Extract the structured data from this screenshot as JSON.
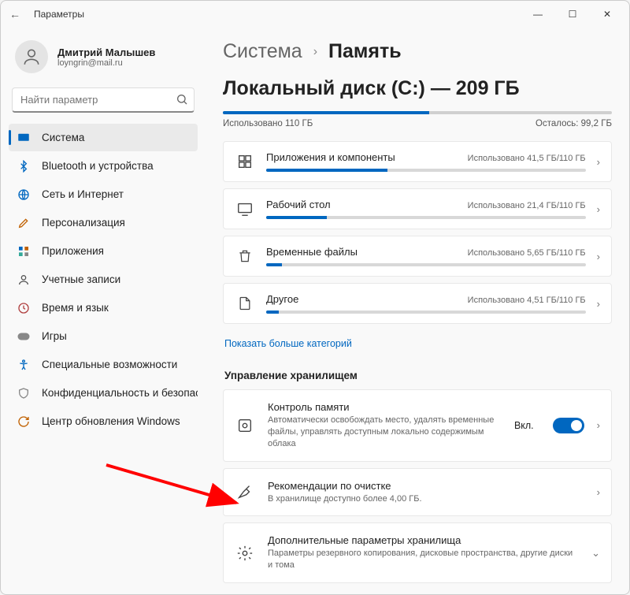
{
  "window": {
    "title": "Параметры"
  },
  "user": {
    "name": "Дмитрий Малышев",
    "email": "loyngrin@mail.ru"
  },
  "search": {
    "placeholder": "Найти параметр"
  },
  "nav": {
    "items": [
      {
        "label": "Система"
      },
      {
        "label": "Bluetooth и устройства"
      },
      {
        "label": "Сеть и Интернет"
      },
      {
        "label": "Персонализация"
      },
      {
        "label": "Приложения"
      },
      {
        "label": "Учетные записи"
      },
      {
        "label": "Время и язык"
      },
      {
        "label": "Игры"
      },
      {
        "label": "Специальные возможности"
      },
      {
        "label": "Конфиденциальность и безопасность"
      },
      {
        "label": "Центр обновления Windows"
      }
    ]
  },
  "breadcrumb": {
    "parent": "Система",
    "current": "Память"
  },
  "disk": {
    "title": "Локальный диск (C:) — 209 ГБ",
    "used_pct": 53,
    "used_label": "Использовано 110 ГБ",
    "free_label": "Осталось: 99,2 ГБ"
  },
  "categories": [
    {
      "title": "Приложения и компоненты",
      "meta": "Использовано 41,5 ГБ/110 ГБ",
      "pct": 38
    },
    {
      "title": "Рабочий стол",
      "meta": "Использовано 21,4 ГБ/110 ГБ",
      "pct": 19
    },
    {
      "title": "Временные файлы",
      "meta": "Использовано 5,65 ГБ/110 ГБ",
      "pct": 5
    },
    {
      "title": "Другое",
      "meta": "Использовано 4,51 ГБ/110 ГБ",
      "pct": 4
    }
  ],
  "more_link": "Показать больше категорий",
  "section_storage_mgmt": "Управление хранилищем",
  "storage_sense": {
    "title": "Контроль памяти",
    "desc": "Автоматически освобождать место, удалять временные файлы, управлять доступным локально содержимым облака",
    "toggle_label": "Вкл.",
    "toggle_on": true
  },
  "cleanup": {
    "title": "Рекомендации по очистке",
    "desc": "В хранилище доступно более 4,00 ГБ."
  },
  "advanced": {
    "title": "Дополнительные параметры хранилища",
    "desc": "Параметры резервного копирования, дисковые пространства, другие диски и тома"
  }
}
